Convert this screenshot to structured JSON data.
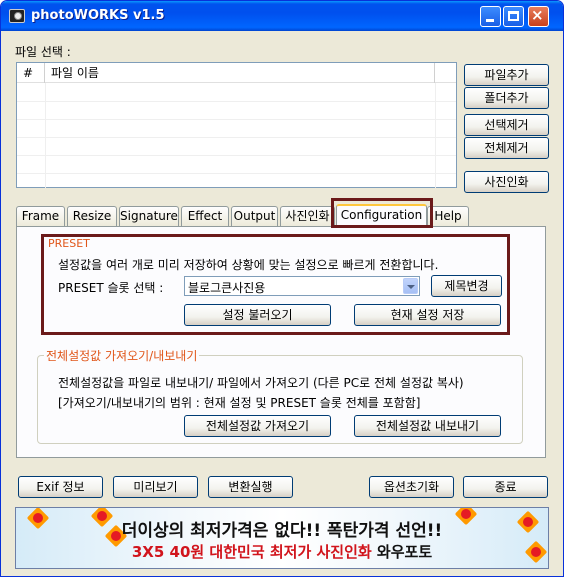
{
  "window": {
    "title": "photoWORKS v1.5"
  },
  "file_section": {
    "label": "파일 선택 :",
    "columns": [
      "#",
      "파일 이름"
    ]
  },
  "side_buttons": {
    "add_file": "파일추가",
    "add_folder": "폴더추가",
    "remove_selected": "선택제거",
    "remove_all": "전체제거",
    "print_photo": "사진인화"
  },
  "tabs": [
    "Frame",
    "Resize",
    "Signature",
    "Effect",
    "Output",
    "사진인화",
    "Configuration",
    "Help"
  ],
  "active_tab": "Configuration",
  "preset": {
    "title": "PRESET",
    "description": "설정값을 여러 개로 미리 저장하여 상황에 맞는 설정으로 빠르게 전환합니다.",
    "slot_label": "PRESET 슬롯 선택 :",
    "slot_value": "블로그큰사진용",
    "rename_button": "제목변경",
    "load_button": "설정 불러오기",
    "save_button": "현재 설정 저장"
  },
  "import_export": {
    "title": "전체설정값 가져오기/내보내기",
    "line1": "전체설정값을 파일로 내보내기/ 파일에서 가져오기 (다른 PC로 전체 설정값 복사)",
    "line2": "[가져오기/내보내기의 범위 : 현재 설정 및 PRESET 슬롯 전체를 포함함]",
    "import_button": "전체설정값 가져오기",
    "export_button": "전체설정값 내보내기"
  },
  "bottom_buttons": {
    "exif": "Exif 정보",
    "preview": "미리보기",
    "convert": "변환실행",
    "reset_options": "옵션초기화",
    "quit": "종료"
  },
  "banner": {
    "line1": "더이상의 최저가격은 없다!! 폭탄가격 선언!!",
    "line2_red": "3X5 40원 대한민국 최저가 사진인화",
    "line2_dark": "와우포토"
  },
  "colors": {
    "title_bar": "#0054e3",
    "highlight_outline": "#6b1a1a",
    "group_title_orange": "#e0561a",
    "banner_red": "#d1141c"
  }
}
